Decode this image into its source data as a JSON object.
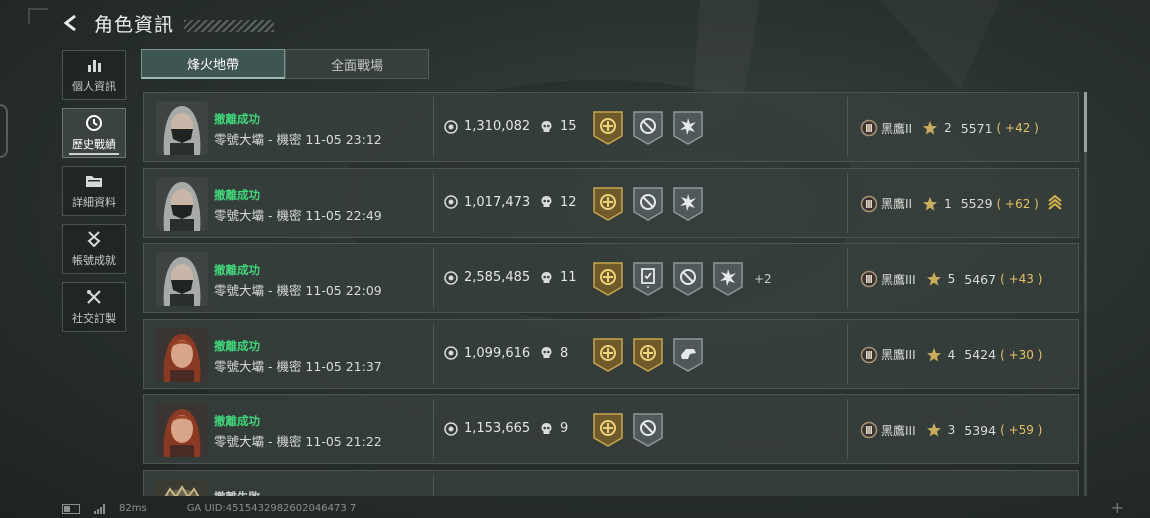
{
  "header": {
    "title": "角色資訊"
  },
  "sidebar": {
    "items": [
      {
        "label": "個人資訊",
        "icon": "bar-chart-icon",
        "active": false
      },
      {
        "label": "歷史戰績",
        "icon": "history-clock-icon",
        "active": true
      },
      {
        "label": "詳細資料",
        "icon": "folder-icon",
        "active": false
      },
      {
        "label": "帳號成就",
        "icon": "achievement-medal-icon",
        "active": false
      },
      {
        "label": "社交訂製",
        "icon": "tools-icon",
        "active": false
      }
    ]
  },
  "tabs": [
    {
      "label": "烽火地帶",
      "active": true
    },
    {
      "label": "全面戰場",
      "active": false
    }
  ],
  "records": [
    {
      "result": "撤離成功",
      "map_time": "零號大壩 - 機密 11-05 23:12",
      "money": "1,310,082",
      "kills": "15",
      "badges": [
        "gold-shield-badge",
        "no-entry-badge",
        "star-burst-badge"
      ],
      "extra": "",
      "rank": "黑鷹II",
      "place": "2",
      "score": "5571",
      "delta": "( +42 )",
      "rank_up": false,
      "avatar": "masked-gray"
    },
    {
      "result": "撤離成功",
      "map_time": "零號大壩 - 機密 11-05 22:49",
      "money": "1,017,473",
      "kills": "12",
      "badges": [
        "gold-shield-badge",
        "no-entry-badge",
        "star-burst-badge"
      ],
      "extra": "",
      "rank": "黑鷹II",
      "place": "1",
      "score": "5529",
      "delta": "( +62 )",
      "rank_up": true,
      "avatar": "masked-gray"
    },
    {
      "result": "撤離成功",
      "map_time": "零號大壩 - 機密 11-05 22:09",
      "money": "2,585,485",
      "kills": "11",
      "badges": [
        "gold-shield-badge",
        "card-badge",
        "no-entry-badge",
        "star-burst-badge"
      ],
      "extra": "+2",
      "rank": "黑鷹III",
      "place": "5",
      "score": "5467",
      "delta": "( +43 )",
      "rank_up": false,
      "avatar": "masked-gray"
    },
    {
      "result": "撤離成功",
      "map_time": "零號大壩 - 機密 11-05 21:37",
      "money": "1,099,616",
      "kills": "8",
      "badges": [
        "gold-shield-badge",
        "gold-shield-badge",
        "hand-badge"
      ],
      "extra": "",
      "rank": "黑鷹III",
      "place": "4",
      "score": "5424",
      "delta": "( +30 )",
      "rank_up": false,
      "avatar": "red-hair"
    },
    {
      "result": "撤離成功",
      "map_time": "零號大壩 - 機密 11-05 21:22",
      "money": "1,153,665",
      "kills": "9",
      "badges": [
        "gold-shield-badge",
        "no-entry-badge"
      ],
      "extra": "",
      "rank": "黑鷹III",
      "place": "3",
      "score": "5394",
      "delta": "( +59 )",
      "rank_up": false,
      "avatar": "red-hair"
    },
    {
      "result": "撤離失敗",
      "map_time": "",
      "money": "",
      "kills": "",
      "badges": [],
      "extra": "",
      "rank": "",
      "place": "",
      "score": "",
      "delta": "",
      "rank_up": false,
      "avatar": "dark-helmet"
    }
  ],
  "footer": {
    "ping": "82ms",
    "uid": "GA UID:4515432982602046473 7"
  },
  "colors": {
    "success": "#41d67a",
    "delta": "#e3c064",
    "gold": "#b8953c"
  }
}
